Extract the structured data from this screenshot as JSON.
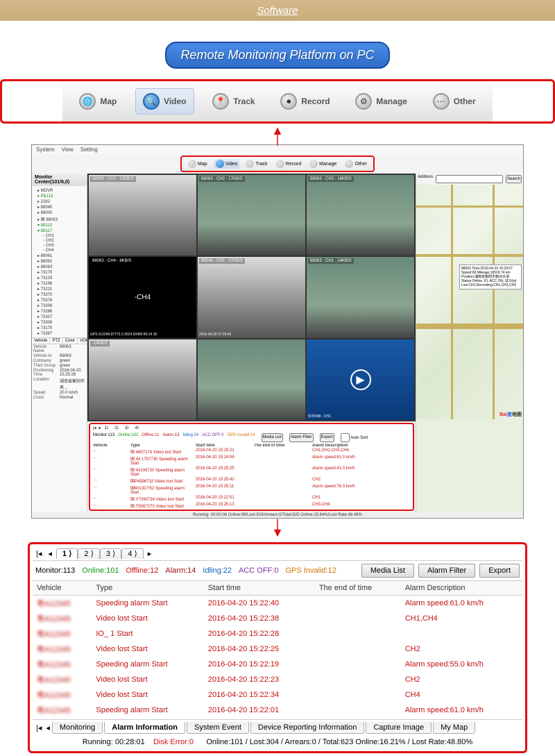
{
  "banner": {
    "title": "Software"
  },
  "title": "Remote Monitoring Platform on PC",
  "nav": {
    "items": [
      {
        "icon": "🌐",
        "label": "Map"
      },
      {
        "icon": "🔍",
        "label": "Video",
        "active": true
      },
      {
        "icon": "📍",
        "label": "Track"
      },
      {
        "icon": "⏺",
        "label": "Record"
      },
      {
        "icon": "⚙",
        "label": "Manage"
      },
      {
        "icon": "⋯",
        "label": "Other"
      }
    ]
  },
  "app": {
    "menubar": [
      "System",
      "View",
      "Setting"
    ],
    "tree": {
      "header": "Monitor Center(101/6,0)",
      "rows": [
        {
          "txt": "▸ MDVR"
        },
        {
          "txt": "▸ P&113",
          "cls": "green"
        },
        {
          "txt": "▸ 2282"
        },
        {
          "txt": "▸ 88045"
        },
        {
          "txt": "▸ 88000"
        },
        {
          "txt": "▸ 国 88063"
        },
        {
          "txt": "▾ 88113",
          "cls": "green"
        },
        {
          "txt": "▾ 88117",
          "cls": "green"
        },
        {
          "txt": "◦ CH1",
          "cls": "lvl2"
        },
        {
          "txt": "◦ CH2",
          "cls": "lvl2"
        },
        {
          "txt": "◦ CH3",
          "cls": "lvl2"
        },
        {
          "txt": "◦ CH4",
          "cls": "lvl2"
        },
        {
          "txt": "▸ 88061"
        },
        {
          "txt": "▸ 88062"
        },
        {
          "txt": "▸ 88063"
        },
        {
          "txt": "▸ 73170"
        },
        {
          "txt": "▸ 73133"
        },
        {
          "txt": "▸ 73198"
        },
        {
          "txt": "▸ 73221"
        },
        {
          "txt": "▸ 73370"
        },
        {
          "txt": "▸ 73376"
        },
        {
          "txt": "▸ 73306"
        },
        {
          "txt": "▸ 73286"
        },
        {
          "txt": "▸ 73307"
        },
        {
          "txt": "▸ 73308"
        },
        {
          "txt": "▸ 73170"
        },
        {
          "txt": "▸ 73387"
        }
      ],
      "tabs": [
        "Vehicle",
        "PTZ",
        "Color",
        "VOIP"
      ]
    },
    "props": [
      {
        "k": "Vehicle Name",
        "v": "88063"
      },
      {
        "k": "Vehicle Id",
        "v": "88063"
      },
      {
        "k": "Company",
        "v": "green"
      },
      {
        "k": "Their Group",
        "v": "green"
      },
      {
        "k": "Positioning Time",
        "v": "2016-04-20 15:25:28"
      },
      {
        "k": "Location",
        "v": "湖南省衡阳市蒸…"
      },
      {
        "k": "Speed",
        "v": "20.0 km/h"
      },
      {
        "k": "Costs",
        "v": "Normal"
      }
    ],
    "videos": [
      {
        "label": "88063 - CH1 - 13KB/S",
        "bottom": "",
        "cls": "street-bg"
      },
      {
        "label": "88063 - CH2 - 17KB/S",
        "bottom": "",
        "cls": "bus-bg"
      },
      {
        "label": "88063 - CH3 - 16KB/S",
        "bottom": "",
        "cls": "bus-bg"
      },
      {
        "label": "88063 - CH4 - 8KB/S",
        "bottom": "GPS:112249.97773 2.2624.93450 80.14 32",
        "cls": "black-bg",
        "content": "-CH4"
      },
      {
        "label": "88048 - CH1 - 17KB/S",
        "bottom": "2016-04-20 07:25:41",
        "cls": "street-bg"
      },
      {
        "label": "88063 - CH1 - 14KB/S",
        "bottom": "",
        "cls": "bus-bg"
      },
      {
        "label": "-14KB/S",
        "bottom": "",
        "cls": "street-bg"
      },
      {
        "label": "",
        "bottom": "",
        "cls": "bus-bg"
      },
      {
        "label": "",
        "bottom": "红外908 - CH1",
        "cls": "blue-bg",
        "play": true
      }
    ],
    "log": {
      "tabs": [
        "1",
        "2",
        "3",
        "4"
      ],
      "monitor": [
        {
          "txt": "Monitor:113",
          "cls": "c-black"
        },
        {
          "txt": "Online:102",
          "cls": "c-green"
        },
        {
          "txt": "Offline:11",
          "cls": "c-red"
        },
        {
          "txt": "Alarm:13",
          "cls": "c-dred"
        },
        {
          "txt": "Idling:24",
          "cls": "c-blue"
        },
        {
          "txt": "ACC OFF:0",
          "cls": "c-purple"
        },
        {
          "txt": "GPS Invalid:14",
          "cls": "c-orange"
        }
      ],
      "headers": [
        "Vehicle",
        "Type",
        "Start time",
        "The end of time",
        "Alarm Description"
      ],
      "rows": [
        [
          "…",
          "国 4657174 Video lost Start",
          "2016-04-20 15:25:21",
          "",
          "CH1,CH2,CH3,CH4"
        ],
        [
          "…",
          "国 44 1757730 Speeding alarm Start",
          "2016-04-20 15:24:56",
          "",
          "Alarm speed:61.0 km/h"
        ],
        [
          "…",
          "国 43106720 Speeding alarm Start",
          "2016-04-20 15:25:25",
          "",
          "Alarm speed:41.0 km/h"
        ],
        [
          "…",
          "国P4596732 Video lost Start",
          "2016-04-20 15:25:42",
          "",
          "CH2"
        ],
        [
          "…",
          "国6013CY52 Speeding alarm Start",
          "2016-04-20 15:25:11",
          "",
          "Alarm speed:76.0 km/h"
        ],
        [
          "…",
          "国 Y7390734 Video lost Start",
          "2016-04-20 15:22:51",
          "",
          "CH1"
        ],
        [
          "…",
          "国 T5067270 Video lost Start",
          "2016-04-20 15:25:13",
          "",
          "CH3,CH4"
        ]
      ]
    },
    "map": {
      "header": {
        "label": "Address",
        "btn": "Search"
      },
      "popup": "88063\nTime:2016-04-20 15:29:07  Speed:60\nMileage:10518.74 km\nPosition:湖南省衡阳市衡州大道\nStatus:Online, IO, ACC ON, SD1(w)\nLive:CH1,Recording:CH1,CH2,CH3",
      "logo": "Bai度地图"
    },
    "status": "Running: 00:00:08             Online:99/Lost:303/Arrears:0/Total:625   Online:15.84%/Lost Rate:48.48%"
  },
  "detail": {
    "pages": [
      "1",
      "2",
      "3",
      "4"
    ],
    "monitor": [
      {
        "txt": "Monitor:113",
        "cls": "c-black"
      },
      {
        "txt": "Online:101",
        "cls": "c-green"
      },
      {
        "txt": "Offline:12",
        "cls": "c-red"
      },
      {
        "txt": "Alarm:14",
        "cls": "c-dred"
      },
      {
        "txt": "Idling:22",
        "cls": "c-blue"
      },
      {
        "txt": "ACC OFF:0",
        "cls": "c-purple"
      },
      {
        "txt": "GPS Invalid:12",
        "cls": "c-orange"
      }
    ],
    "buttons": [
      "Media List",
      "Alarm Filter",
      "Export"
    ],
    "headers": [
      "Vehicle",
      "Type",
      "Start time",
      "The end of time",
      "Alarm Description"
    ],
    "rows": [
      [
        "…",
        "Speeding alarm Start",
        "2016-04-20 15:22:40",
        "",
        "Alarm speed:61.0 km/h"
      ],
      [
        "…",
        "Video lost Start",
        "2016-04-20 15:22:38",
        "",
        "CH1,CH4"
      ],
      [
        "…",
        "IO_ 1 Start",
        "2016-04-20 15:22:28",
        "",
        ""
      ],
      [
        "…",
        "Video lost Start",
        "2016-04-20 15:22:25",
        "",
        "CH2"
      ],
      [
        "…",
        "Speeding alarm Start",
        "2016-04-20 15:22:19",
        "",
        "Alarm speed:55.0 km/h"
      ],
      [
        "…",
        "Video lost Start",
        "2016-04-20 15:22:23",
        "",
        "CH2"
      ],
      [
        "…",
        "Video lost Start",
        "2016-04-20 15:22:34",
        "",
        "CH4"
      ],
      [
        "…",
        "Speeding alarm Start",
        "2016-04-20 15:22:01",
        "",
        "Alarm speed:61.0 km/h"
      ]
    ],
    "bottom_tabs": [
      "Monitoring",
      "Alarm Information",
      "System Event",
      "Device Reporting Information",
      "Capture Image",
      "My Map"
    ],
    "status": {
      "running": "Running: 00:28:01",
      "disk": "Disk Error:0",
      "online": "Online:101 / Lost:304 / Arrears:0 / Total:623   Online:16.21% / Lost Rate:48.80%"
    }
  }
}
